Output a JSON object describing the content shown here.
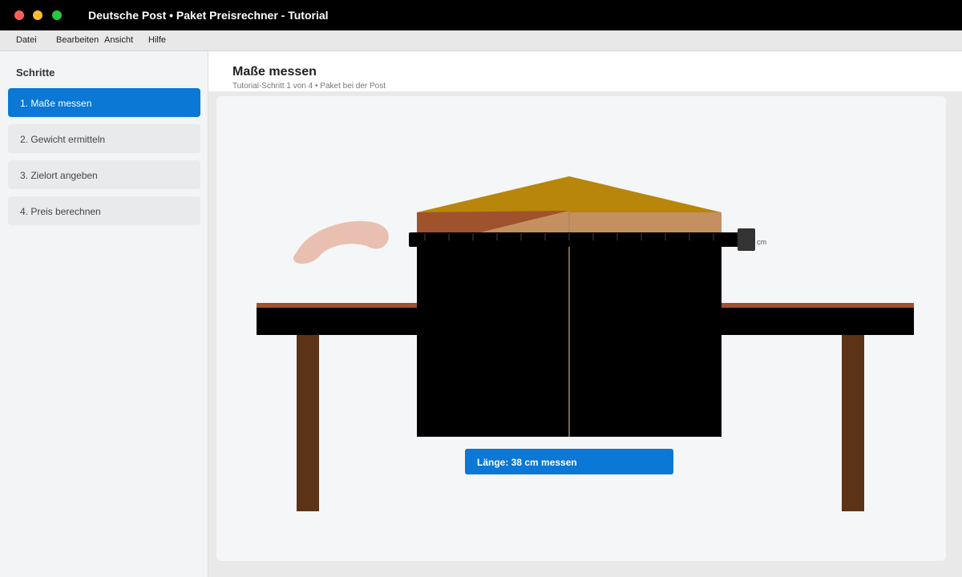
{
  "window": {
    "title": "Deutsche Post • Paket Preisrechner - Tutorial"
  },
  "menu": {
    "items": [
      "Datei",
      "Bearbeiten",
      "Ansicht",
      "Hilfe"
    ]
  },
  "sidebar": {
    "heading": "Schritte",
    "steps": [
      {
        "label": "1. Maße messen",
        "active": true
      },
      {
        "label": "2. Gewicht ermitteln",
        "active": false
      },
      {
        "label": "3. Zielort angeben",
        "active": false
      },
      {
        "label": "4. Preis berechnen",
        "active": false
      }
    ]
  },
  "main": {
    "title": "Maße messen",
    "subtitle": "Tutorial-Schritt 1 von 4 • Paket bei der Post",
    "tape_unit": "cm",
    "callout": "Länge: 38 cm messen"
  },
  "colors": {
    "accent": "#0a78d4",
    "box_lid": "#b8860b",
    "box_flap_dark": "#a0522d",
    "box_flap_light": "#c49060",
    "table_leg": "#5c3317",
    "table_edge": "#a0522d",
    "hand": "#e8bfb0"
  }
}
